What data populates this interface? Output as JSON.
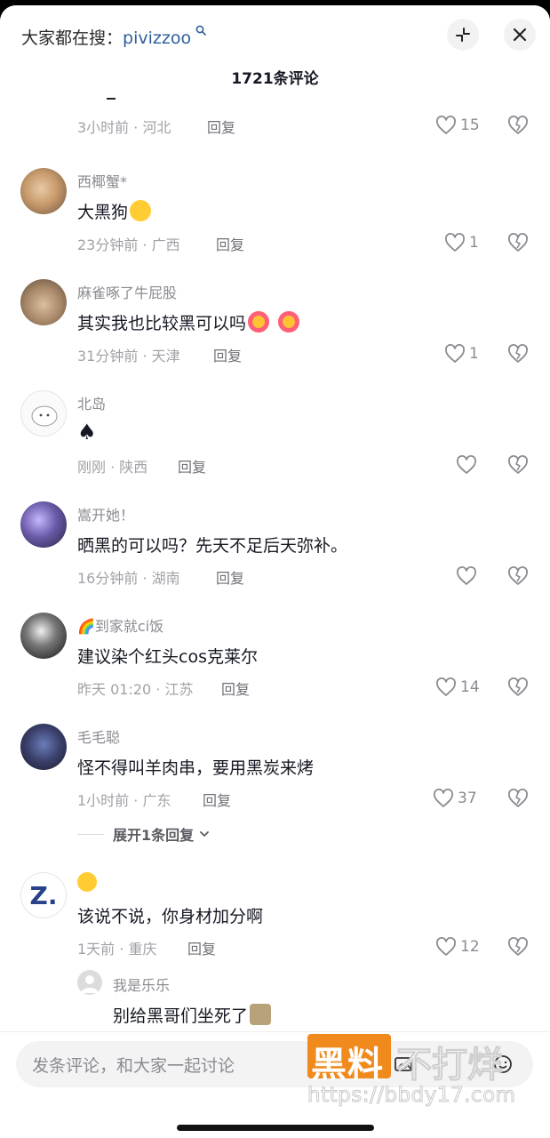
{
  "header": {
    "search_prefix": "大家都在搜：",
    "search_keyword": "pivizzoo",
    "comment_count": "1721条评论"
  },
  "colors": {
    "accent_link": "#2f5d9e",
    "heart": "#8a8b91",
    "watermark_orange": "#f08a1c"
  },
  "icons": [
    "search-icon",
    "minimize-icon",
    "close-icon",
    "heart-icon",
    "dislike-heart-icon",
    "chevron-down-icon",
    "image-icon",
    "emoji-icon"
  ],
  "comments": [
    {
      "partial": true,
      "time": "3小时前 · 河北",
      "reply": "回复",
      "likes": "15"
    },
    {
      "user": "西椰蟹*",
      "text": "大黑狗",
      "emoji": "emoji-flushed",
      "time": "23分钟前 · 广西",
      "reply": "回复",
      "likes": "1"
    },
    {
      "user": "麻雀啄了牛屁股",
      "text": "其实我也比较黑可以吗",
      "emoji": "emoji-heart-eyes",
      "time": "31分钟前 · 天津",
      "reply": "回复",
      "likes": "1"
    },
    {
      "user": "北岛",
      "text": "♠",
      "time": "刚刚 · 陕西",
      "reply": "回复",
      "likes": ""
    },
    {
      "user": "嵩开她！",
      "text": "晒黑的可以吗？先天不足后天弥补。",
      "time": "16分钟前 · 湖南",
      "reply": "回复",
      "likes": ""
    },
    {
      "user": "🌈到家就ci饭",
      "text": "建议染个红头cos克莱尔",
      "time": "昨天 01:20 · 江苏",
      "reply": "回复",
      "likes": "14"
    },
    {
      "user": "毛毛聪",
      "text": "怪不得叫羊肉串，要用黑炭来烤",
      "time": "1小时前 · 广东",
      "reply": "回复",
      "likes": "37",
      "expand": "展开1条回复"
    },
    {
      "user": "",
      "text": "该说不说，你身材加分啊",
      "time": "1天前 · 重庆",
      "reply": "回复",
      "likes": "12"
    }
  ],
  "subreply": {
    "user": "我是乐乐",
    "text": "别给黑哥们坐死了"
  },
  "footer": {
    "placeholder": "发条评论，和大家一起讨论"
  },
  "watermark": {
    "brand": "黑料",
    "tagline": "不打烊",
    "url": "https://bbdy17.com"
  }
}
